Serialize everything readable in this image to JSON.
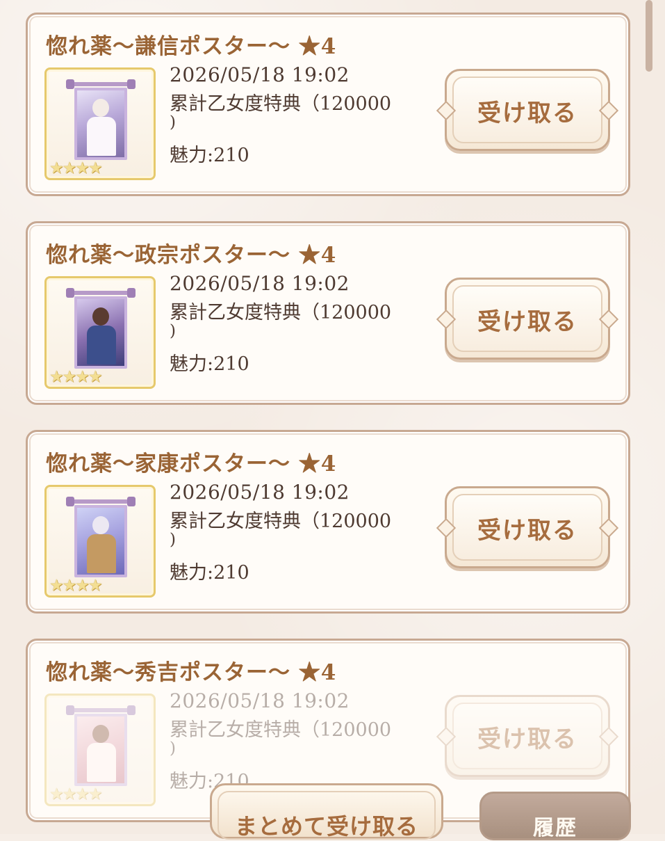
{
  "items": [
    {
      "title": "惚れ薬～謙信ポスター～ ★4",
      "date": "2026/05/18 19:02",
      "bonus": "累計乙女度特典（120000",
      "bonus_close": ")",
      "charm": "魅力:210",
      "stars": "★★★★",
      "button_label": "受け取る"
    },
    {
      "title": "惚れ薬～政宗ポスター～ ★4",
      "date": "2026/05/18 19:02",
      "bonus": "累計乙女度特典（120000",
      "bonus_close": ")",
      "charm": "魅力:210",
      "stars": "★★★★",
      "button_label": "受け取る"
    },
    {
      "title": "惚れ薬～家康ポスター～ ★4",
      "date": "2026/05/18 19:02",
      "bonus": "累計乙女度特典（120000",
      "bonus_close": ")",
      "charm": "魅力:210",
      "stars": "★★★★",
      "button_label": "受け取る"
    },
    {
      "title": "惚れ薬～秀吉ポスター～ ★4",
      "date": "2026/05/18 19:02",
      "bonus": "累計乙女度特典（120000",
      "bonus_close": ")",
      "charm": "魅力:210",
      "stars": "★★★★",
      "button_label": "受け取る"
    }
  ],
  "footer": {
    "bulk_label": "まとめて受け取る",
    "history_label": "履歴"
  },
  "colors": {
    "title": "#9a6435",
    "text": "#4e3a31",
    "button_text": "#a66c3e",
    "card_border": "#c7a892",
    "history_bg": "#b39b8b"
  }
}
